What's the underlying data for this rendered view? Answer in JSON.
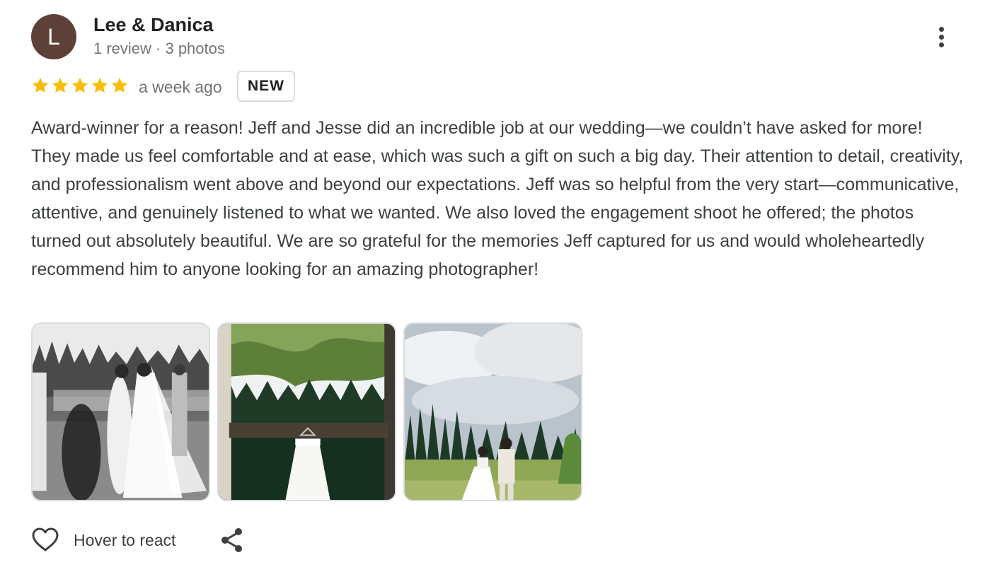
{
  "reviewer": {
    "initial": "L",
    "name": "Lee & Danica",
    "meta": "1 review · 3 photos",
    "avatar_color": "#5d4037"
  },
  "rating": {
    "stars": 5,
    "max": 5,
    "star_color": "#fbbc04",
    "time_ago": "a week ago",
    "badge": "NEW"
  },
  "review_text": "Award-winner for a reason! Jeff and Jesse did an incredible job at our wedding—we couldn’t have asked for more! They made us feel comfortable and at ease, which was such a gift on such a big day. Their attention to detail, creativity, and professionalism went above and beyond our expectations. Jeff was so helpful from the very start—communicative, attentive, and genuinely listened to what we wanted. We also loved the engagement shoot he offered; the photos turned out absolutely beautiful. We are so grateful for the memories Jeff captured for us and would wholeheartedly recommend him to anyone looking for an amazing photographer!",
  "photos": [
    {
      "name": "photo-wedding-ceremony-bw"
    },
    {
      "name": "photo-wedding-dress-hanging"
    },
    {
      "name": "photo-couple-in-meadow"
    }
  ],
  "actions": {
    "react_label": "Hover to react",
    "react_icon": "heart-icon",
    "share_icon": "share-icon",
    "more_icon": "more-vert-icon"
  }
}
